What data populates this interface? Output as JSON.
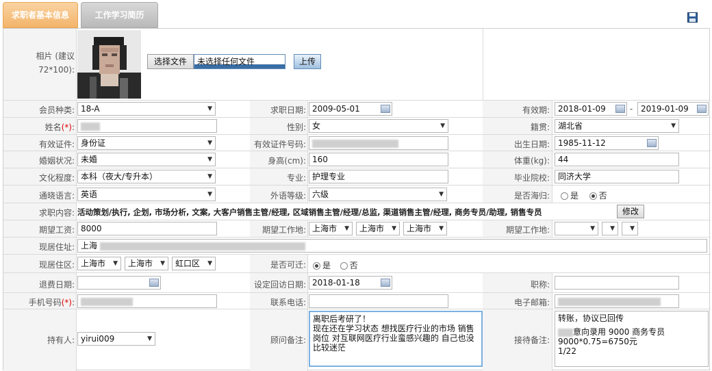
{
  "tabs": [
    {
      "label": "求职者基本信息"
    },
    {
      "label": "工作学习简历"
    }
  ],
  "photo": {
    "label": "相片 (建议72*100):",
    "choose_label": "选择文件",
    "no_file_label": "未选择任何文件",
    "upload_label": "上传"
  },
  "fields": {
    "member_type": {
      "label": "会员种类:",
      "value": "18-A"
    },
    "apply_date": {
      "label": "求职日期:",
      "value": "2009-05-01"
    },
    "valid_period": {
      "label": "有效期:",
      "from": "2018-01-09",
      "sep": "-",
      "to": "2019-01-09"
    },
    "name": {
      "label": "姓名",
      "req": "(*)",
      "colon": ":"
    },
    "gender": {
      "label": "性别:",
      "value": "女"
    },
    "native_place": {
      "label": "籍贯:",
      "value": "湖北省"
    },
    "id_type": {
      "label": "有效证件:",
      "value": "身份证"
    },
    "id_number": {
      "label": "有效证件号码:"
    },
    "birth_date": {
      "label": "出生日期:",
      "value": "1985-11-12"
    },
    "marital": {
      "label": "婚姻状况:",
      "value": "未婚"
    },
    "height": {
      "label": "身高(cm):",
      "value": "160"
    },
    "weight": {
      "label": "体重(kg):",
      "value": "44"
    },
    "education": {
      "label": "文化程度:",
      "value": "本科（夜大/专升本）"
    },
    "major": {
      "label": "专业:",
      "value": "护理专业"
    },
    "school": {
      "label": "毕业院校:",
      "value": "同济大学"
    },
    "language": {
      "label": "通晓语言:",
      "value": "英语"
    },
    "lang_level": {
      "label": "外语等级:",
      "value": "六级"
    },
    "returnee": {
      "label": "是否海归:",
      "yes": "是",
      "no": "否"
    },
    "job_content": {
      "label": "求职内容:",
      "value": "活动策划/执行, 企划, 市场分析, 文案, 大客户销售主管/经理, 区域销售主管/经理/总监, 渠道销售主管/经理, 商务专员/助理, 销售专员",
      "edit_label": "修改"
    },
    "salary": {
      "label": "期望工资:",
      "value": "8000"
    },
    "work_place": {
      "label": "期望工作地:",
      "v1": "上海市",
      "v2": "上海市",
      "v3": "上海市"
    },
    "work_place2": {
      "label": "期望工作地:"
    },
    "address": {
      "label": "现居住址:",
      "value": "上海"
    },
    "district": {
      "label": "现居住区:",
      "v1": "上海市",
      "v2": "上海市",
      "v3": "虹口区"
    },
    "relocate": {
      "label": "是否可迁:",
      "yes": "是",
      "no": "否"
    },
    "refund_date": {
      "label": "退费日期:"
    },
    "revisit_date": {
      "label": "设定回访日期:",
      "value": "2018-01-18"
    },
    "title": {
      "label": "职称:"
    },
    "mobile": {
      "label": "手机号码",
      "req": "(*)",
      "colon": ":"
    },
    "phone": {
      "label": "联系电话:"
    },
    "email": {
      "label": "电子邮箱:"
    },
    "holder": {
      "label": "持有人:",
      "value": "yirui009"
    },
    "consultant_note": {
      "label": "顾问备注:",
      "value": "离职后考研了！\n现在还在学习状态  想找医疗行业的市场 销售岗位 对互联网医疗行业蛮感兴趣的 自己也没比较迷茫"
    },
    "reception_note": {
      "label": "接待备注:",
      "line1": "转账，协议已回传",
      "line2": "意向录用  9000  商务专员",
      "line3": "9000*0.75=6750元",
      "line4": "1/22"
    }
  }
}
